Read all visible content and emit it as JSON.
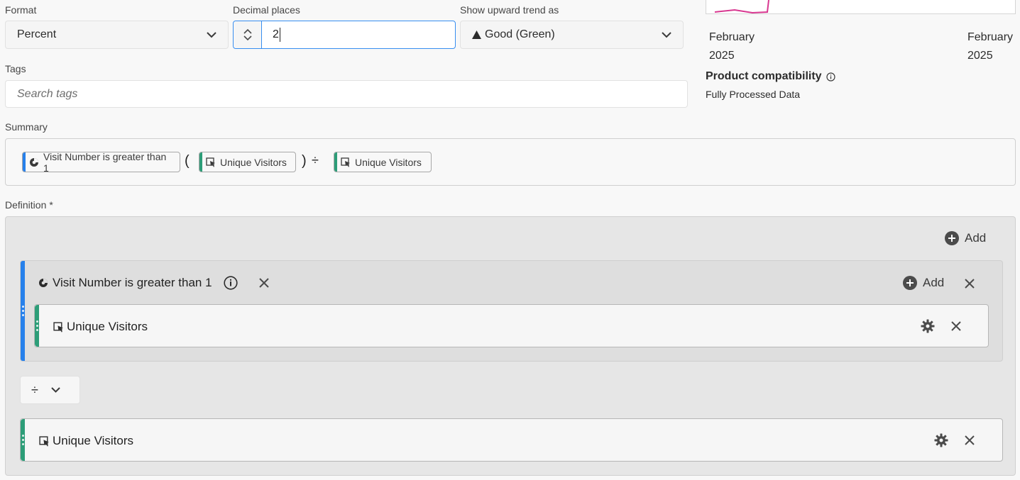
{
  "format": {
    "label": "Format",
    "value": "Percent"
  },
  "decimal": {
    "label": "Decimal places",
    "value": "2"
  },
  "trend": {
    "label": "Show upward trend as",
    "value": "Good (Green)"
  },
  "preview": {
    "start_month": "February",
    "start_year": "2025",
    "end_month": "February",
    "end_year": "2025",
    "line_color": "#d83790"
  },
  "compat": {
    "title": "Product compatibility",
    "value": "Fully Processed Data"
  },
  "tags": {
    "label": "Tags",
    "placeholder": "Search tags"
  },
  "summary": {
    "label": "Summary",
    "segment": "Visit Number is greater than 1",
    "open_paren": "(",
    "metric1": "Unique Visitors",
    "close_paren": ")",
    "operator": "÷",
    "metric2": "Unique Visitors"
  },
  "definition": {
    "label": "Definition",
    "required_mark": "*",
    "add_label": "Add",
    "container": {
      "title": "Visit Number is greater than 1",
      "add_label": "Add",
      "metric": "Unique Visitors"
    },
    "operator": "÷",
    "metric": "Unique Visitors"
  },
  "colors": {
    "segment_bar": "#2680eb",
    "metric_bar": "#2d9d78",
    "accent": "#378ef0"
  }
}
